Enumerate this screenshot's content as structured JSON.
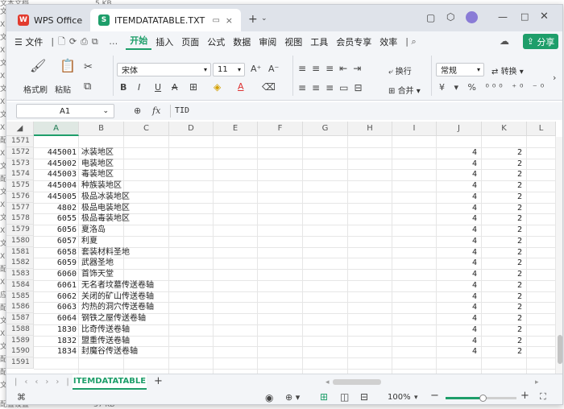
{
  "background_files": {
    "top_left": "文本文档",
    "top_size": "5 KB",
    "bottom_left": "配置设置",
    "bottom_size": "37 KB",
    "side_labels": [
      "文",
      "XL",
      "文",
      "XL",
      "文",
      "XL",
      "文",
      "XL",
      "文",
      "XL",
      "配",
      "XL",
      "文",
      "配",
      "文",
      "XL",
      "文",
      "XL",
      "文",
      "XL",
      "配",
      "XL",
      "应",
      "配",
      "文",
      "XL",
      "文",
      "配",
      "配",
      "文"
    ]
  },
  "window": {
    "app_tab": "WPS Office",
    "file_tab": "ITEMDATATABLE.TXT",
    "app_logo": "W",
    "file_logo": "S"
  },
  "menu": {
    "file": "文件",
    "items": [
      "开始",
      "插入",
      "页面",
      "公式",
      "数据",
      "审阅",
      "视图",
      "工具",
      "会员专享",
      "效率"
    ],
    "share": "分享"
  },
  "ribbon": {
    "format_painter": "格式刷",
    "paste": "粘贴",
    "font_name": "宋体",
    "font_size": "11",
    "wrap": "换行",
    "merge": "合并",
    "number_format": "常规",
    "convert": "转换"
  },
  "formula_bar": {
    "cell_ref": "A1",
    "fx": "fx",
    "content": "TID"
  },
  "columns": [
    "A",
    "B",
    "C",
    "D",
    "E",
    "F",
    "G",
    "H",
    "I",
    "J",
    "K",
    "L"
  ],
  "rows": [
    {
      "n": "1571",
      "a": "",
      "b": "",
      "j": "",
      "k": ""
    },
    {
      "n": "1572",
      "a": "445001",
      "b": "冰装地区",
      "j": "4",
      "k": "2"
    },
    {
      "n": "1573",
      "a": "445002",
      "b": "电装地区",
      "j": "4",
      "k": "2"
    },
    {
      "n": "1574",
      "a": "445003",
      "b": "毒装地区",
      "j": "4",
      "k": "2"
    },
    {
      "n": "1575",
      "a": "445004",
      "b": "种族装地区",
      "j": "4",
      "k": "2"
    },
    {
      "n": "1576",
      "a": "445005",
      "b": "极品冰装地区",
      "j": "4",
      "k": "2"
    },
    {
      "n": "1577",
      "a": "4802",
      "b": "极品电装地区",
      "j": "4",
      "k": "2"
    },
    {
      "n": "1578",
      "a": "6055",
      "b": "极品毒装地区",
      "j": "4",
      "k": "2"
    },
    {
      "n": "1579",
      "a": "6056",
      "b": "夏洛岛",
      "j": "4",
      "k": "2"
    },
    {
      "n": "1580",
      "a": "6057",
      "b": "利夏",
      "j": "4",
      "k": "2"
    },
    {
      "n": "1581",
      "a": "6058",
      "b": "套装材料圣地",
      "j": "4",
      "k": "2"
    },
    {
      "n": "1582",
      "a": "6059",
      "b": "武器圣地",
      "j": "4",
      "k": "2"
    },
    {
      "n": "1583",
      "a": "6060",
      "b": "首饰天堂",
      "j": "4",
      "k": "2"
    },
    {
      "n": "1584",
      "a": "6061",
      "b": "无名者坟墓传送卷轴",
      "j": "4",
      "k": "2"
    },
    {
      "n": "1585",
      "a": "6062",
      "b": "关闭的矿山传送卷轴",
      "j": "4",
      "k": "2"
    },
    {
      "n": "1586",
      "a": "6063",
      "b": "灼热的洞穴传送卷轴",
      "j": "4",
      "k": "2"
    },
    {
      "n": "1587",
      "a": "6064",
      "b": "钢铁之屋传送卷轴",
      "j": "4",
      "k": "2"
    },
    {
      "n": "1588",
      "a": "1830",
      "b": "比奇传送卷轴",
      "j": "4",
      "k": "2"
    },
    {
      "n": "1589",
      "a": "1832",
      "b": "盟重传送卷轴",
      "j": "4",
      "k": "2"
    },
    {
      "n": "1590",
      "a": "1834",
      "b": "封魔谷传送卷轴",
      "j": "4",
      "k": "2"
    },
    {
      "n": "1591",
      "a": "",
      "b": "",
      "j": "",
      "k": ""
    }
  ],
  "sheet_tab": "ITEMDATATABLE",
  "status": {
    "zoom": "100%"
  },
  "colors": {
    "accent": "#1e9e6a",
    "brand_red": "#e23b2e"
  }
}
